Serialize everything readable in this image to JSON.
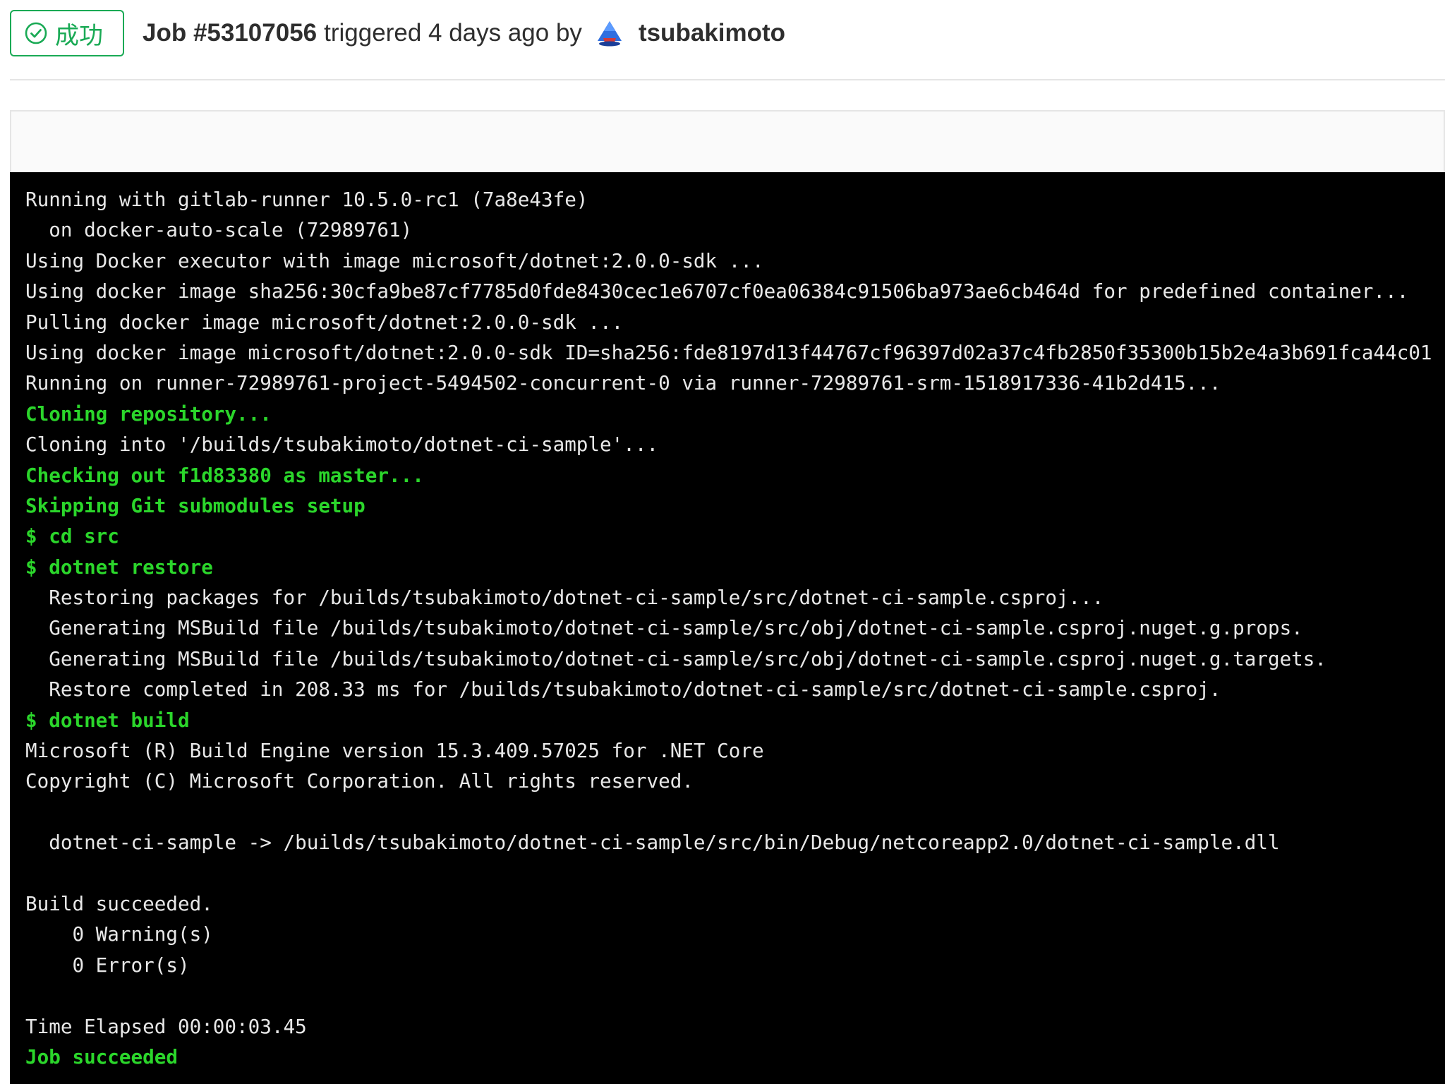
{
  "header": {
    "status_label": "成功",
    "job_title": "Job #53107056",
    "triggered_text": "triggered 4 days ago by",
    "user_name": "tsubakimoto"
  },
  "colors": {
    "success": "#1aaa55",
    "terminal_bg": "#000000",
    "terminal_text": "#e8e8e8",
    "terminal_ok": "#2bd62b"
  },
  "icons": {
    "status": "check-circle-icon",
    "avatar": "user-avatar-icon"
  },
  "log": [
    {
      "text": "Running with gitlab-runner 10.5.0-rc1 (7a8e43fe)",
      "style": "normal"
    },
    {
      "text": "  on docker-auto-scale (72989761)",
      "style": "normal"
    },
    {
      "text": "Using Docker executor with image microsoft/dotnet:2.0.0-sdk ...",
      "style": "normal"
    },
    {
      "text": "Using docker image sha256:30cfa9be87cf7785d0fde8430cec1e6707cf0ea06384c91506ba973ae6cb464d for predefined container...",
      "style": "normal"
    },
    {
      "text": "Pulling docker image microsoft/dotnet:2.0.0-sdk ...",
      "style": "normal"
    },
    {
      "text": "Using docker image microsoft/dotnet:2.0.0-sdk ID=sha256:fde8197d13f44767cf96397d02a37c4fb2850f35300b15b2e4a3b691fca44c01",
      "style": "normal"
    },
    {
      "text": "Running on runner-72989761-project-5494502-concurrent-0 via runner-72989761-srm-1518917336-41b2d415...",
      "style": "normal"
    },
    {
      "text": "Cloning repository...",
      "style": "ok"
    },
    {
      "text": "Cloning into '/builds/tsubakimoto/dotnet-ci-sample'...",
      "style": "normal"
    },
    {
      "text": "Checking out f1d83380 as master...",
      "style": "ok"
    },
    {
      "text": "Skipping Git submodules setup",
      "style": "ok"
    },
    {
      "text": "$ cd src",
      "style": "ok"
    },
    {
      "text": "$ dotnet restore",
      "style": "ok"
    },
    {
      "text": "  Restoring packages for /builds/tsubakimoto/dotnet-ci-sample/src/dotnet-ci-sample.csproj...",
      "style": "normal"
    },
    {
      "text": "  Generating MSBuild file /builds/tsubakimoto/dotnet-ci-sample/src/obj/dotnet-ci-sample.csproj.nuget.g.props.",
      "style": "normal"
    },
    {
      "text": "  Generating MSBuild file /builds/tsubakimoto/dotnet-ci-sample/src/obj/dotnet-ci-sample.csproj.nuget.g.targets.",
      "style": "normal"
    },
    {
      "text": "  Restore completed in 208.33 ms for /builds/tsubakimoto/dotnet-ci-sample/src/dotnet-ci-sample.csproj.",
      "style": "normal"
    },
    {
      "text": "$ dotnet build",
      "style": "ok"
    },
    {
      "text": "Microsoft (R) Build Engine version 15.3.409.57025 for .NET Core",
      "style": "normal"
    },
    {
      "text": "Copyright (C) Microsoft Corporation. All rights reserved.",
      "style": "normal"
    },
    {
      "text": "",
      "style": "normal"
    },
    {
      "text": "  dotnet-ci-sample -> /builds/tsubakimoto/dotnet-ci-sample/src/bin/Debug/netcoreapp2.0/dotnet-ci-sample.dll",
      "style": "normal"
    },
    {
      "text": "",
      "style": "normal"
    },
    {
      "text": "Build succeeded.",
      "style": "normal"
    },
    {
      "text": "    0 Warning(s)",
      "style": "normal"
    },
    {
      "text": "    0 Error(s)",
      "style": "normal"
    },
    {
      "text": "",
      "style": "normal"
    },
    {
      "text": "Time Elapsed 00:00:03.45",
      "style": "normal"
    },
    {
      "text": "Job succeeded",
      "style": "ok"
    }
  ]
}
